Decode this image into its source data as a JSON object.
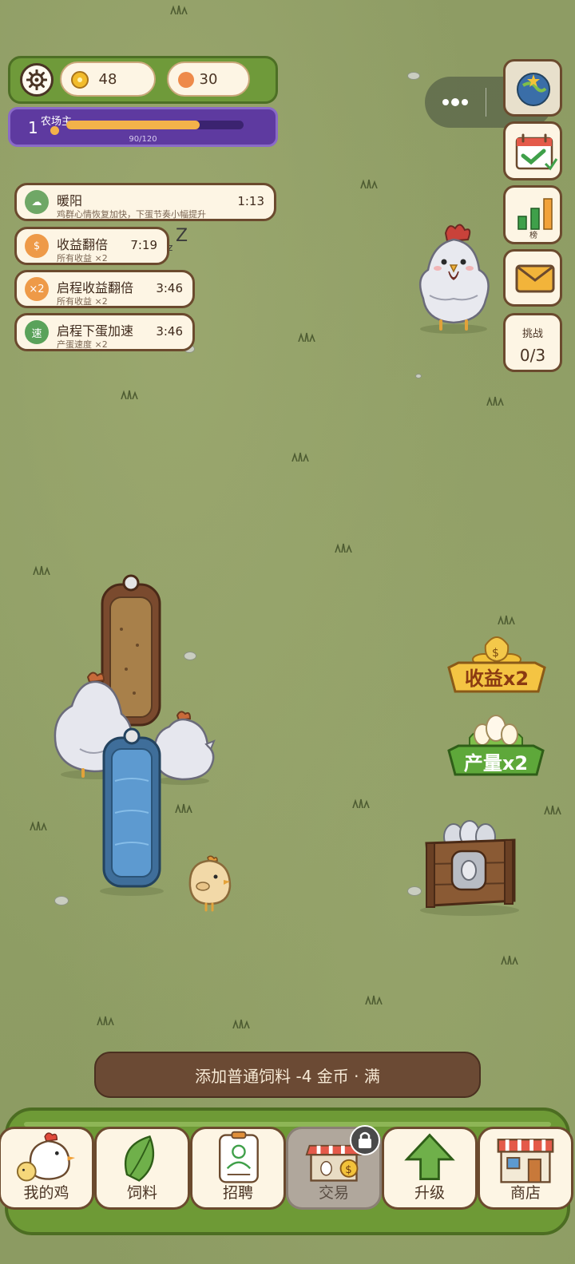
{
  "resources": {
    "coins": "48",
    "gems": "30"
  },
  "level": {
    "number": "1",
    "title": "农场主",
    "xp_text": "90/120",
    "xp_fraction": 0.75
  },
  "buffs": [
    {
      "name": "暖阳",
      "desc": "鸡群心情恢复加快，下蛋节奏小幅提升",
      "time": "1:13",
      "icon": "cloud-sun-icon",
      "icon_glyph": "☁",
      "color": "#6fa766"
    },
    {
      "name": "收益翻倍",
      "desc": "所有收益 ×2",
      "time": "7:19",
      "icon": "dollar-icon",
      "icon_glyph": "$",
      "color": "#ee9a48"
    },
    {
      "name": "启程收益翻倍",
      "desc": "所有收益 ×2",
      "time": "3:46",
      "icon": "x2-icon",
      "icon_glyph": "×2",
      "color": "#ee9a48"
    },
    {
      "name": "启程下蛋加速",
      "desc": "产蛋速度 ×2",
      "time": "3:46",
      "icon": "speed-icon",
      "icon_glyph": "速",
      "color": "#5aa25a"
    }
  ],
  "side": {
    "rank_label": "榜",
    "challenge_label": "挑战",
    "challenge_count": "0/3"
  },
  "badges": {
    "income": "收益x2",
    "output": "产量x2"
  },
  "toast": "添加普通饲料 -4 金币 · 满",
  "nav": [
    {
      "label": "我的鸡",
      "icon": "chicken-icon"
    },
    {
      "label": "饲料",
      "icon": "leaf-icon"
    },
    {
      "label": "招聘",
      "icon": "recruit-card-icon"
    },
    {
      "label": "交易",
      "icon": "market-stall-icon",
      "locked": true
    },
    {
      "label": "升级",
      "icon": "arrow-up-icon"
    },
    {
      "label": "商店",
      "icon": "shop-icon"
    }
  ]
}
